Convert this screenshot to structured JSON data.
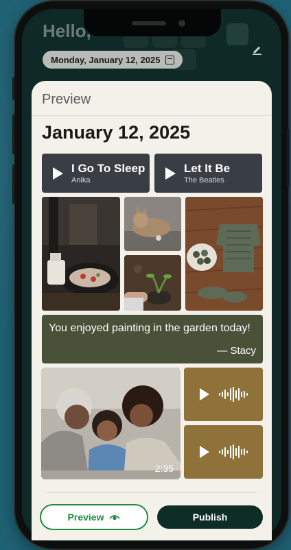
{
  "header": {
    "greeting": "Hello,",
    "date_pill": "Monday, January 12, 2025"
  },
  "sheet": {
    "label": "Preview",
    "title": "January 12, 2025",
    "songs": [
      {
        "title": "I Go To Sleep",
        "artist": "Anika"
      },
      {
        "title": "Let It Be",
        "artist": "The Beatles"
      }
    ],
    "quote": {
      "text": "You enjoyed painting in the garden today!",
      "author": "— Stacy"
    },
    "video_duration": "2:35"
  },
  "actions": {
    "preview_label": "Preview",
    "publish_label": "Publish"
  },
  "icons": [
    "calendar-icon",
    "edit-icon",
    "play-icon",
    "waveform-icon",
    "eye-icon"
  ],
  "colors": {
    "background": "#1f6174",
    "sheet": "#f3f1ea",
    "song_card": "#393e45",
    "quote_card": "#495138",
    "audio_card": "#8e723a",
    "accent_green": "#1f8a3a",
    "publish": "#0d2d25"
  }
}
